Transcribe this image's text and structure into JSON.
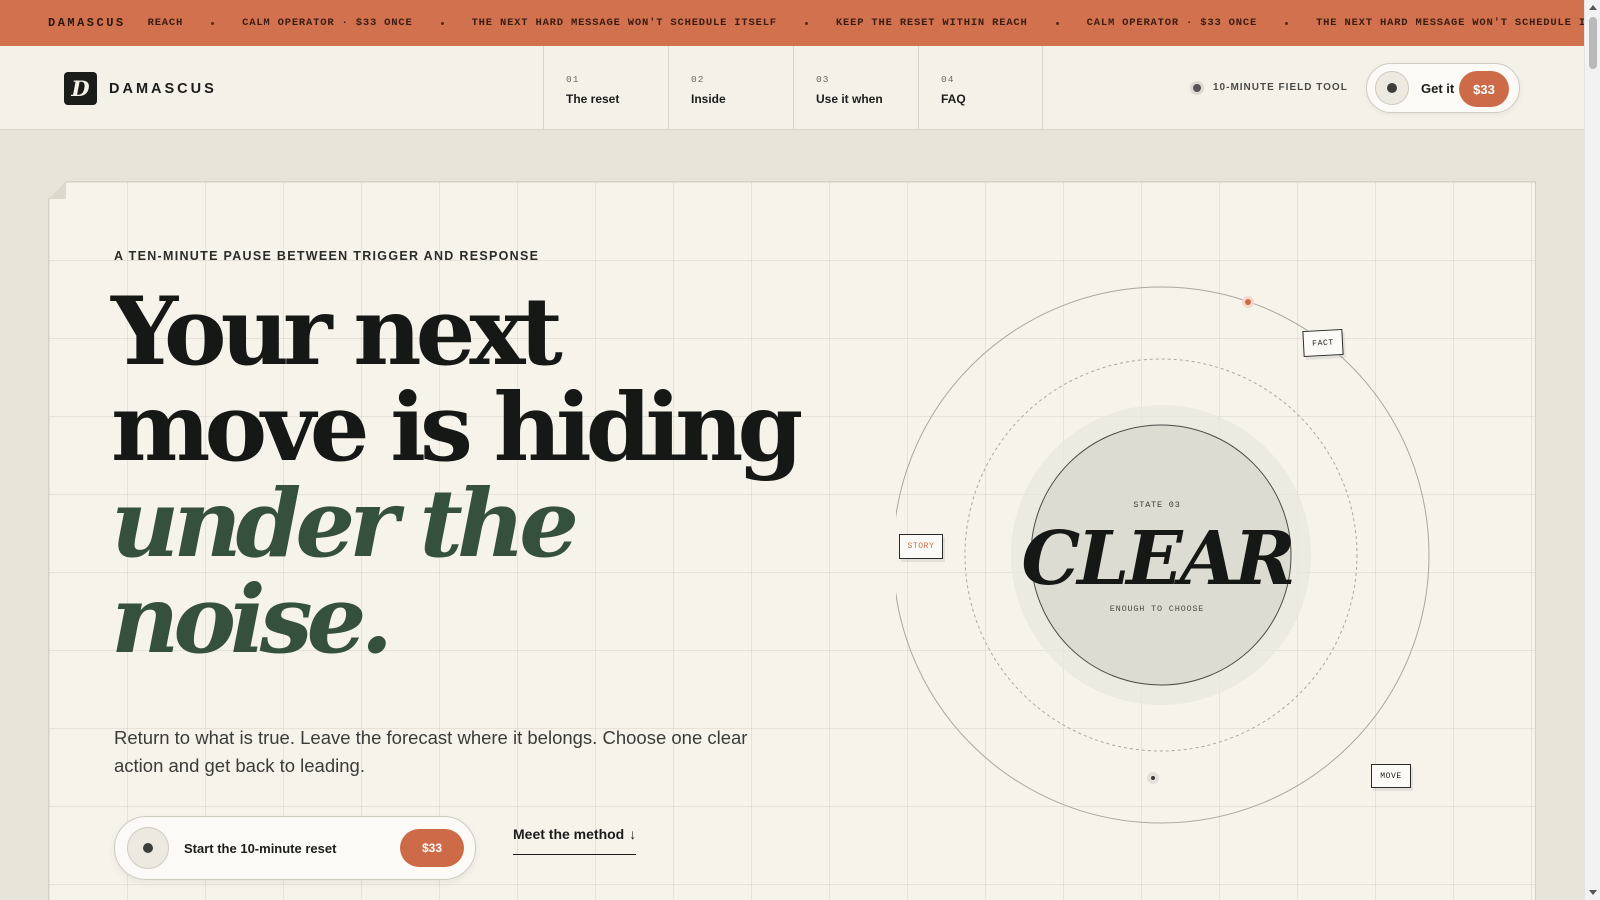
{
  "ticker": {
    "brand": "DAMASCUS",
    "items": [
      "REACH",
      "CALM OPERATOR · $33 ONCE",
      "THE NEXT HARD MESSAGE WON'T SCHEDULE ITSELF",
      "KEEP THE RESET WITHIN REACH",
      "CALM OPERATOR · $33 ONCE",
      "THE NEXT HARD MESSAGE WON'T SCHEDULE ITSELF"
    ]
  },
  "nav": {
    "logo_mark": "D",
    "logo_text": "DAMASCUS",
    "links": [
      {
        "num": "01",
        "label": "The reset"
      },
      {
        "num": "02",
        "label": "Inside"
      },
      {
        "num": "03",
        "label": "Use it when"
      },
      {
        "num": "04",
        "label": "FAQ"
      }
    ],
    "field_tool": "10-MINUTE FIELD TOOL",
    "cta_label": "Get it",
    "cta_price": "$33"
  },
  "hero": {
    "eyebrow": "A TEN-MINUTE PAUSE BETWEEN TRIGGER AND RESPONSE",
    "headline": {
      "line1": "Your next",
      "line2": "move is hiding",
      "line3": "under the",
      "line4": "noise."
    },
    "lede": "Return to what is true. Leave the forecast where it belongs. Choose one clear action and get back to leading.",
    "cta_label": "Start the 10-minute reset",
    "cta_price": "$33",
    "method_link": "Meet the method",
    "method_arrow": "↓"
  },
  "orbit": {
    "state_number": "STATE 03",
    "state_word": "CLEAR",
    "state_sub": "ENOUGH TO CHOOSE",
    "labels": {
      "fact": "FACT",
      "story": "STORY",
      "move": "MOVE"
    },
    "colors": {
      "accent": "#cd6b49",
      "story_text": "#cd6b49"
    }
  },
  "colors": {
    "ticker_bg": "#d2714e",
    "accent": "#cd6b49",
    "headline_accent": "#35503c",
    "page_bg": "#e7e4da",
    "card_bg": "#f6f3eb"
  }
}
